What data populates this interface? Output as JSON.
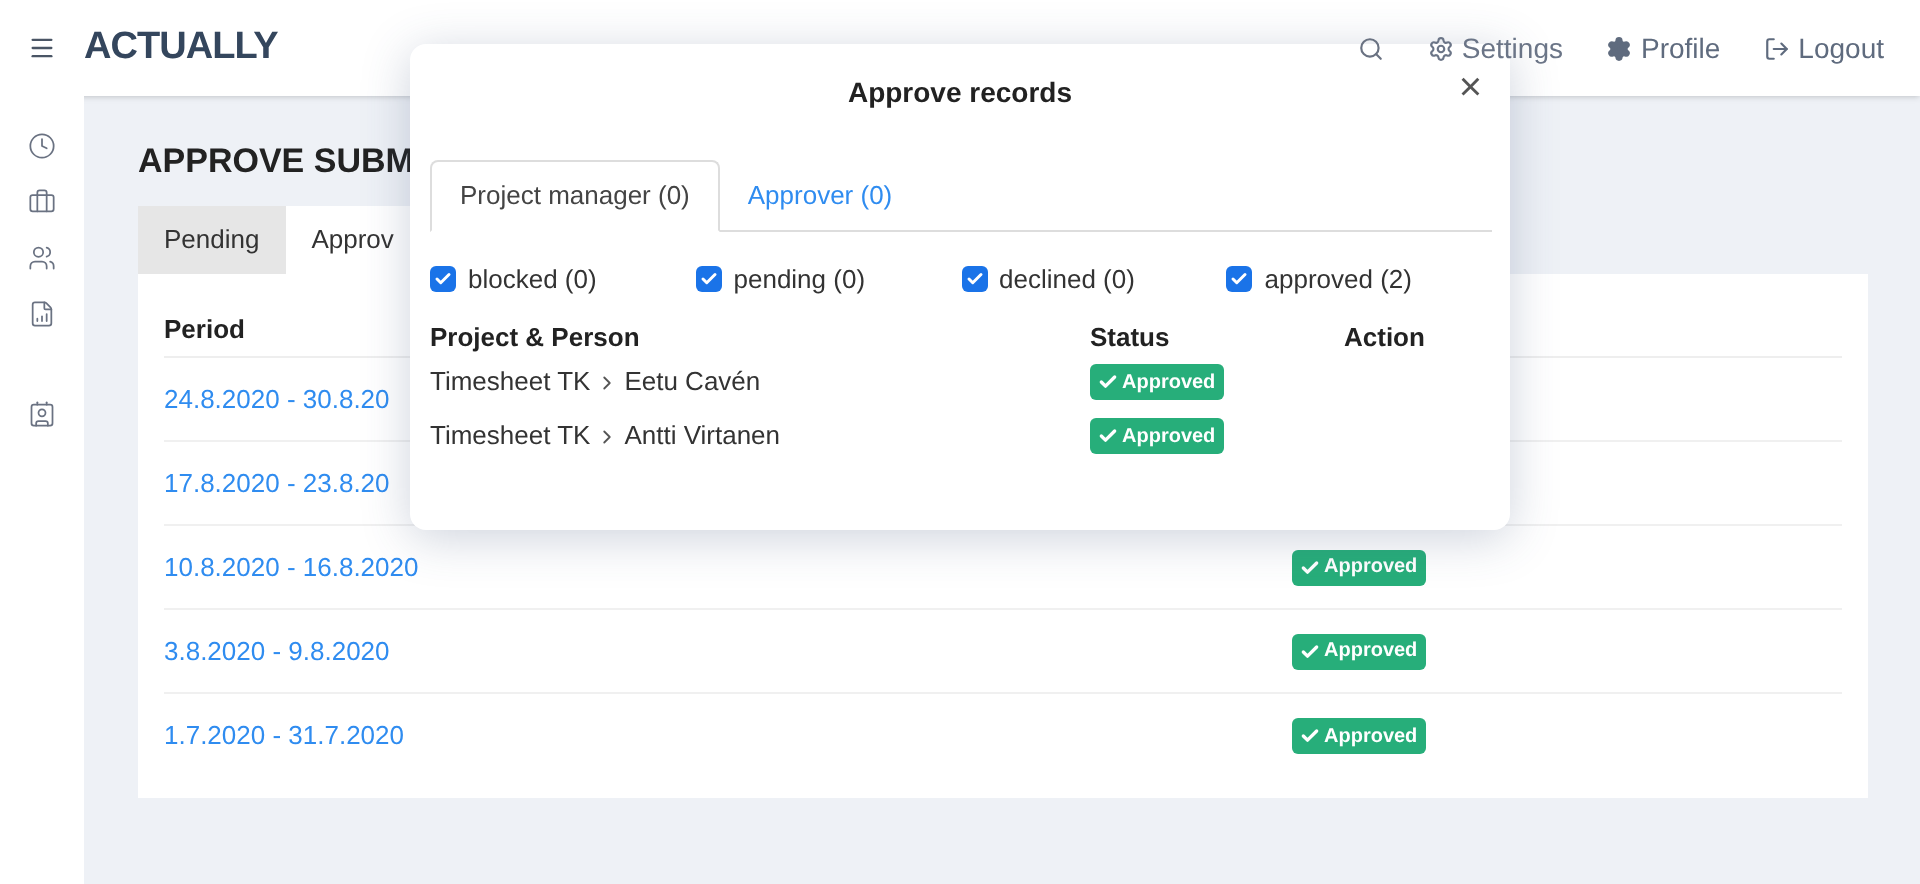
{
  "header": {
    "logo": "ACTUALLY",
    "nav": [
      {
        "kind": "search"
      },
      {
        "kind": "settings",
        "label": "Settings"
      },
      {
        "kind": "profile",
        "label": "Profile"
      },
      {
        "kind": "logout",
        "label": "Logout"
      }
    ]
  },
  "sidebar": {
    "items": [
      {
        "kind": "clock"
      },
      {
        "kind": "briefcase"
      },
      {
        "kind": "users"
      },
      {
        "kind": "report"
      },
      {
        "kind": "badge"
      }
    ]
  },
  "page": {
    "title": "APPROVE SUBM",
    "tabs": [
      {
        "label": "Pending",
        "selected": false
      },
      {
        "label": "Approv",
        "selected": true
      }
    ],
    "table": {
      "columns": [
        "Period"
      ],
      "rows": [
        {
          "period": "24.8.2020 - 30.8.20"
        },
        {
          "period": "17.8.2020 - 23.8.20"
        },
        {
          "period": "10.8.2020 - 16.8.2020",
          "status": "Approved"
        },
        {
          "period": "3.8.2020 - 9.8.2020",
          "status": "Approved"
        },
        {
          "period": "1.7.2020 - 31.7.2020",
          "status": "Approved"
        }
      ]
    }
  },
  "modal": {
    "title": "Approve records",
    "close": "×",
    "tabs": [
      {
        "label": "Project manager (0)",
        "selected": true
      },
      {
        "label": "Approver (0)",
        "selected": false
      }
    ],
    "filters": [
      {
        "label": "blocked (0)",
        "checked": true
      },
      {
        "label": "pending (0)",
        "checked": true
      },
      {
        "label": "declined (0)",
        "checked": true
      },
      {
        "label": "approved (2)",
        "checked": true
      }
    ],
    "columns": [
      "Project & Person",
      "Status",
      "Action"
    ],
    "rows": [
      {
        "project": "Timesheet TK",
        "person": "Eetu Cavén",
        "status": "Approved"
      },
      {
        "project": "Timesheet TK",
        "person": "Antti Virtanen",
        "status": "Approved"
      }
    ]
  }
}
